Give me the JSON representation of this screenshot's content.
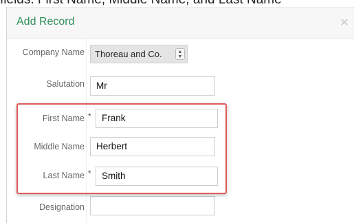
{
  "caption": "fields: First Name, Middle Name, and Last Name",
  "dialog": {
    "title": "Add Record",
    "close_icon": "close-icon",
    "accent_color": "#2f8f5a",
    "highlight_color": "#e05a5a"
  },
  "form": {
    "company": {
      "label": "Company Name",
      "value": "Thoreau and Co."
    },
    "salutation": {
      "label": "Salutation",
      "value": "Mr"
    },
    "first_name": {
      "label": "First Name",
      "required_marker": "*",
      "value": "Frank"
    },
    "middle_name": {
      "label": "Middle Name",
      "value": "Herbert"
    },
    "last_name": {
      "label": "Last Name",
      "required_marker": "*",
      "value": "Smith"
    },
    "designation": {
      "label": "Designation",
      "value": ""
    }
  }
}
